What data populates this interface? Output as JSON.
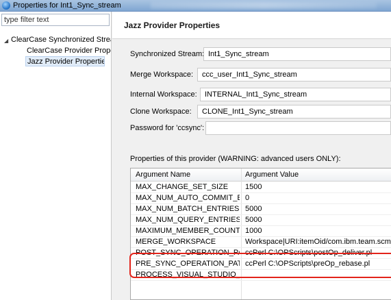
{
  "window": {
    "title": "Properties for Int1_Sync_stream"
  },
  "nav": {
    "filter_placeholder": "type filter text",
    "items": [
      {
        "label": "ClearCase Synchronized Strea",
        "expanded": true
      },
      {
        "label": "ClearCase Provider Prope"
      },
      {
        "label": "Jazz Provider Properties",
        "selected": true
      }
    ]
  },
  "page": {
    "title": "Jazz Provider Properties",
    "fields": [
      {
        "label": "Synchronized Stream:",
        "value": "Int1_Sync_stream"
      },
      {
        "label": "Merge Workspace:",
        "value": "ccc_user_Int1_Sync_stream"
      },
      {
        "label": "Internal Workspace:",
        "value": "INTERNAL_Int1_Sync_stream"
      },
      {
        "label": "Clone Workspace:",
        "value": "CLONE_Int1_Sync_stream"
      },
      {
        "label": "Password for 'ccsync':",
        "value": ""
      }
    ],
    "properties_label": "Properties of this provider (WARNING: advanced users ONLY):"
  },
  "table": {
    "headers": [
      "Argument Name",
      "Argument Value"
    ],
    "rows": [
      {
        "name": "MAX_CHANGE_SET_SIZE",
        "value": "1500"
      },
      {
        "name": "MAX_NUM_AUTO_COMMIT_E...",
        "value": "0"
      },
      {
        "name": "MAX_NUM_BATCH_ENTRIES",
        "value": "5000"
      },
      {
        "name": "MAX_NUM_QUERY_ENTRIES",
        "value": "5000"
      },
      {
        "name": "MAXIMUM_MEMBER_COUNT",
        "value": "1000"
      },
      {
        "name": "MERGE_WORKSPACE",
        "value": "Workspace|URI:itemOid/com.ibm.team.scm."
      },
      {
        "name": "POST_SYNC_OPERATION_PATH",
        "value": "ccPerl C:\\OPScripts\\postOp_deliver.pl"
      },
      {
        "name": "PRE_SYNC_OPERATION_PATH",
        "value": "ccPerl C:\\OPScripts\\preOp_rebase.pl"
      },
      {
        "name": "PROCESS_VISUAL_STUDIO_FILES",
        "value": ""
      }
    ]
  },
  "colors": {
    "highlight": "#e2231a",
    "titlebar": "#8fb0d8"
  }
}
